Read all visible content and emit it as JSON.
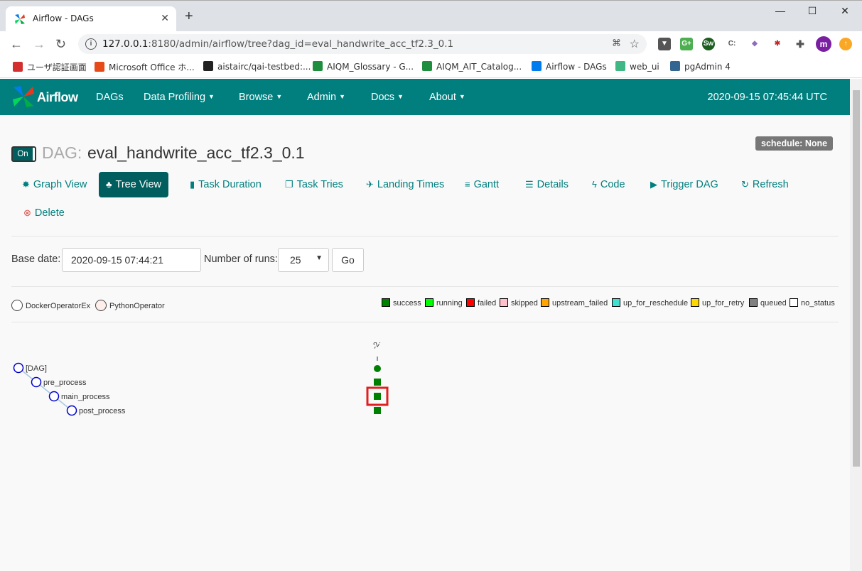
{
  "browser": {
    "tab_title": "Airflow - DAGs",
    "url_host": "127.0.0.1",
    "url_rest": ":8180/admin/airflow/tree?dag_id=eval_handwrite_acc_tf2.3_0.1",
    "profile_initial": "m",
    "bookmarks": [
      {
        "label": "ユーザ認証画面",
        "color": "#d32f2f"
      },
      {
        "label": "Microsoft Office ホ...",
        "color": "#e64a19"
      },
      {
        "label": "aistairc/qai-testbed:...",
        "color": "#222222"
      },
      {
        "label": "AIQM_Glossary - G...",
        "color": "#1e8e3e"
      },
      {
        "label": "AIQM_AIT_Catalog...",
        "color": "#1e8e3e"
      },
      {
        "label": "Airflow - DAGs",
        "color": "#017cee"
      },
      {
        "label": "web_ui",
        "color": "#41b883"
      },
      {
        "label": "pgAdmin 4",
        "color": "#336791"
      }
    ]
  },
  "navbar": {
    "brand": "Airflow",
    "items": [
      "DAGs",
      "Data Profiling",
      "Browse",
      "Admin",
      "Docs",
      "About"
    ],
    "time": "2020-09-15 07:45:44 UTC",
    "color": "#017f7f"
  },
  "dag": {
    "toggle": "On",
    "label": "DAG:",
    "id": "eval_handwrite_acc_tf2.3_0.1",
    "schedule": "schedule: None"
  },
  "views": [
    {
      "label": "Graph View",
      "icon": "asterisk-icon"
    },
    {
      "label": "Tree View",
      "icon": "tree-icon",
      "active": true
    },
    {
      "label": "Task Duration",
      "icon": "bar-chart-icon"
    },
    {
      "label": "Task Tries",
      "icon": "files-icon"
    },
    {
      "label": "Landing Times",
      "icon": "plane-icon"
    },
    {
      "label": "Gantt",
      "icon": "align-left-icon"
    },
    {
      "label": "Details",
      "icon": "list-icon"
    },
    {
      "label": "Code",
      "icon": "flash-icon"
    },
    {
      "label": "Trigger DAG",
      "icon": "play-circle-icon"
    },
    {
      "label": "Refresh",
      "icon": "refresh-icon"
    },
    {
      "label": "Delete",
      "icon": "remove-circle-icon"
    }
  ],
  "form": {
    "base_date_label": "Base date:",
    "base_date_value": "2020-09-15 07:44:21",
    "runs_label": "Number of runs:",
    "runs_value": "25",
    "go": "Go"
  },
  "operators": [
    {
      "name": "DockerOperatorEx",
      "color": "#ffffff"
    },
    {
      "name": "PythonOperator",
      "color": "#ffefeb"
    }
  ],
  "states": [
    {
      "name": "success",
      "color": "#008000"
    },
    {
      "name": "running",
      "color": "#00ff00"
    },
    {
      "name": "failed",
      "color": "#ff0000"
    },
    {
      "name": "skipped",
      "color": "#ffc0cb"
    },
    {
      "name": "upstream_failed",
      "color": "#ffa500"
    },
    {
      "name": "up_for_reschedule",
      "color": "#40e0d0"
    },
    {
      "name": "up_for_retry",
      "color": "#ffd700"
    },
    {
      "name": "queued",
      "color": "#808080"
    },
    {
      "name": "no_status",
      "color": "#ffffff"
    }
  ],
  "tree": {
    "nodes": [
      "[DAG]",
      "pre_process",
      "main_process",
      "post_process"
    ],
    "run_label": "-21",
    "task_states": [
      "success",
      "success",
      "success"
    ]
  }
}
